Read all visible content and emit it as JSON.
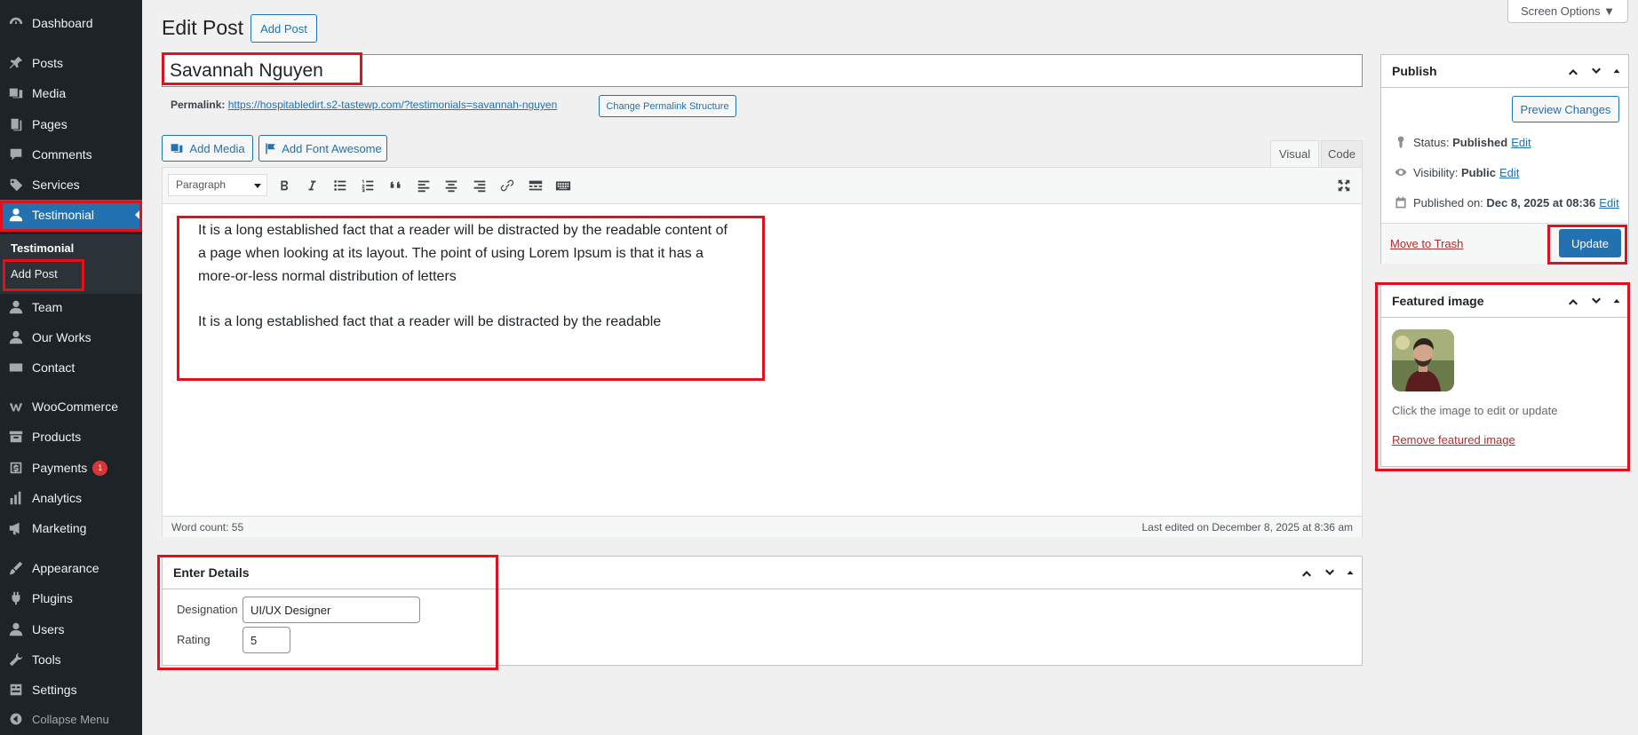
{
  "sidebar": {
    "items": [
      {
        "label": "Dashboard",
        "icon": "dashboard-icon"
      },
      {
        "label": "Posts",
        "icon": "pin-icon"
      },
      {
        "label": "Media",
        "icon": "media-icon"
      },
      {
        "label": "Pages",
        "icon": "pages-icon"
      },
      {
        "label": "Comments",
        "icon": "comment-icon"
      },
      {
        "label": "Services",
        "icon": "tag-icon"
      },
      {
        "label": "Testimonial",
        "icon": "user-icon"
      },
      {
        "label": "Team",
        "icon": "user-icon"
      },
      {
        "label": "Our Works",
        "icon": "user-icon"
      },
      {
        "label": "Contact",
        "icon": "mail-icon"
      },
      {
        "label": "WooCommerce",
        "icon": "woo-icon"
      },
      {
        "label": "Products",
        "icon": "archive-icon"
      },
      {
        "label": "Payments",
        "icon": "dollar-icon",
        "badge": "1"
      },
      {
        "label": "Analytics",
        "icon": "chart-icon"
      },
      {
        "label": "Marketing",
        "icon": "megaphone-icon"
      },
      {
        "label": "Appearance",
        "icon": "brush-icon"
      },
      {
        "label": "Plugins",
        "icon": "plugin-icon"
      },
      {
        "label": "Users",
        "icon": "user-icon"
      },
      {
        "label": "Tools",
        "icon": "wrench-icon"
      },
      {
        "label": "Settings",
        "icon": "settings-icon"
      }
    ],
    "submenu": {
      "title": "Testimonial",
      "item": "Add Post"
    },
    "collapse_label": "Collapse Menu"
  },
  "header": {
    "title": "Edit Post",
    "add_post_label": "Add Post",
    "screen_options": "Screen Options ▼"
  },
  "post": {
    "title_value": "Savannah Nguyen",
    "permalink_label": "Permalink:",
    "permalink_url": "https://hospitabledirt.s2-tastewp.com/?testimonials=savannah-nguyen",
    "change_permalink": "Change Permalink Structure"
  },
  "editor": {
    "add_media": "Add Media",
    "add_font_awesome": "Add Font Awesome",
    "tab_visual": "Visual",
    "tab_code": "Code",
    "format": "Paragraph",
    "paragraphs": [
      "It is a long established fact that a reader will be distracted by the readable content of a page when looking at its layout. The point of using Lorem Ipsum is that it has a more-or-less normal distribution of letters",
      "It is a long established fact that a reader will be distracted by the readable"
    ],
    "word_count": "Word count: 55",
    "last_edited": "Last edited on December 8, 2025 at 8:36 am"
  },
  "details": {
    "title": "Enter Details",
    "designation_label": "Designation",
    "designation_value": "UI/UX Designer",
    "rating_label": "Rating",
    "rating_value": "5"
  },
  "publish": {
    "title": "Publish",
    "preview": "Preview Changes",
    "status_label": "Status:",
    "status_value": "Published",
    "visibility_label": "Visibility:",
    "visibility_value": "Public",
    "published_label": "Published on:",
    "published_value": "Dec 8, 2025 at 08:36",
    "edit": "Edit",
    "trash": "Move to Trash",
    "update": "Update"
  },
  "featured": {
    "title": "Featured image",
    "hint": "Click the image to edit or update",
    "remove": "Remove featured image"
  },
  "colors": {
    "accent": "#2271b1",
    "sidebar": "#1d2327",
    "highlight": "#e0101c"
  }
}
